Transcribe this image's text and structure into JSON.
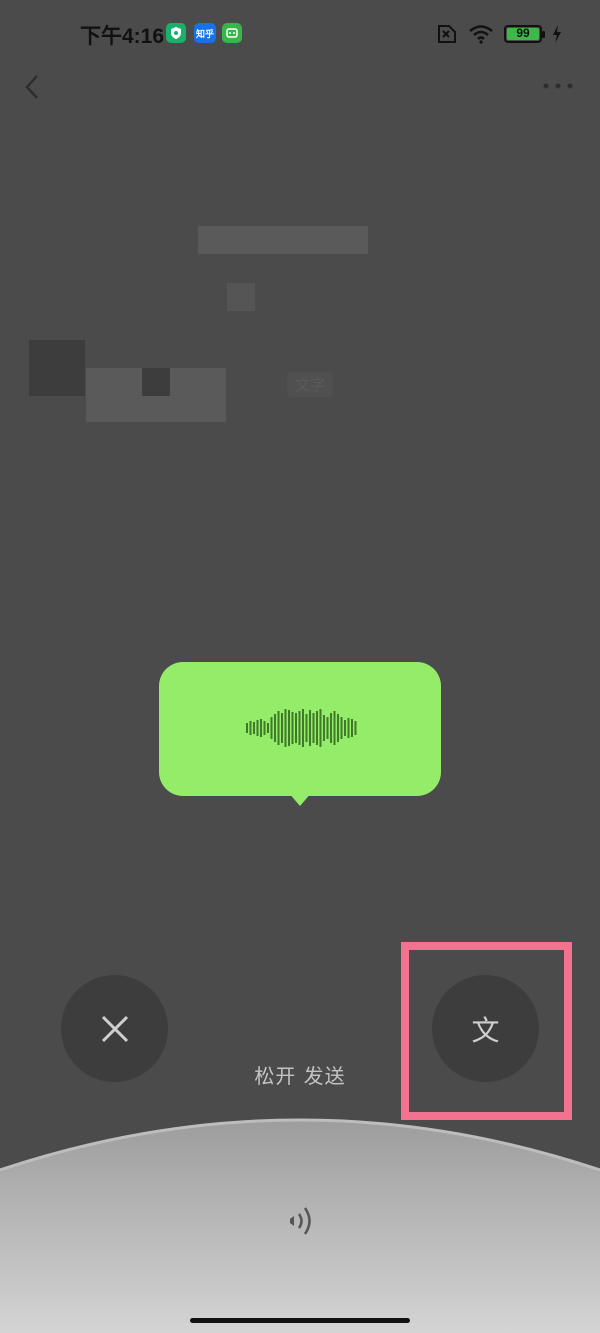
{
  "status_bar": {
    "time": "下午4:16",
    "app_icons": [
      {
        "name": "shield-app-icon",
        "label": ""
      },
      {
        "name": "zhihu-app-icon",
        "label": "知乎"
      },
      {
        "name": "green-app-icon",
        "label": ""
      }
    ],
    "battery_level": "99",
    "battery_fraction": 0.99
  },
  "chat_header": {
    "title": "",
    "back_icon": "chevron-left-icon",
    "more_icon": "more-dots-icon"
  },
  "chat": {
    "recall_label": "文字"
  },
  "voice_recording": {
    "release_hint": "松开 发送",
    "cancel_icon": "close-icon",
    "convert_label": "文",
    "bubble_color": "#95ec69",
    "speaker_icon": "speaker-icon"
  },
  "colors": {
    "overlay": "#4b4b4b",
    "button": "#3d3d3d",
    "highlight": "#f2728f",
    "bubble": "#95ec69"
  }
}
